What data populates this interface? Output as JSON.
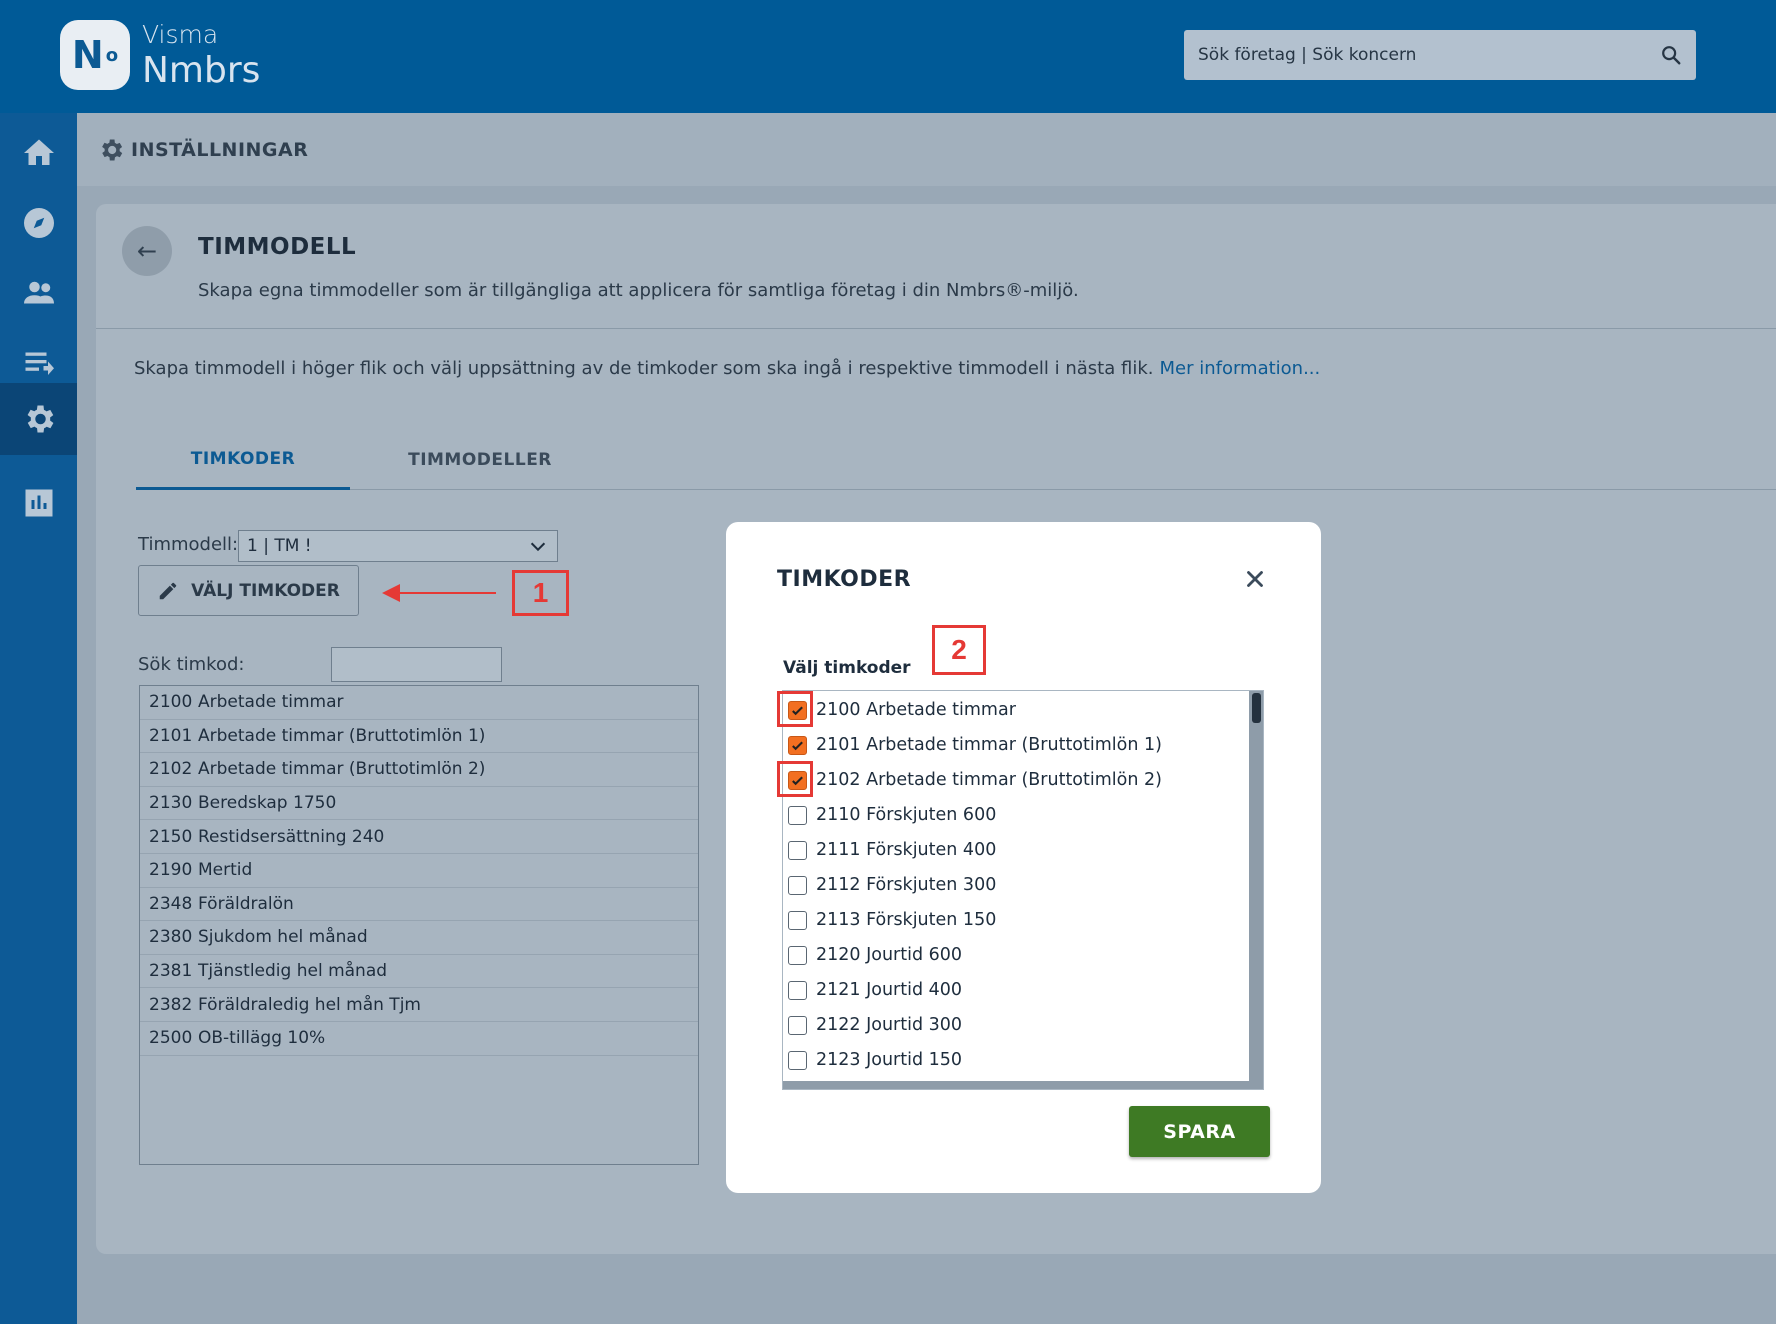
{
  "brand": {
    "logo_text": "N",
    "logo_sup": "o",
    "line1": "Visma",
    "line2": "Nmbrs"
  },
  "search": {
    "placeholder": "Sök företag | Sök koncern"
  },
  "nav": [
    "home-icon",
    "compass-icon",
    "people-icon",
    "list-icon",
    "gear-icon",
    "chart-icon"
  ],
  "breadcrumb": {
    "label": "INSTÄLLNINGAR"
  },
  "page": {
    "back": "←",
    "title": "TIMMODELL",
    "subtitle": "Skapa egna timmodeller som är tillgängliga att applicera för samtliga företag i din Nmbrs®-miljö.",
    "info": "Skapa timmodell i höger flik och välj uppsättning av de timkoder som ska ingå i respektive timmodell i nästa flik.",
    "info_link": "Mer information..."
  },
  "tabs": [
    {
      "label": "TIMKODER",
      "active": true
    },
    {
      "label": "TIMMODELLER",
      "active": false
    }
  ],
  "form": {
    "timmodell_label": "Timmodell:",
    "timmodell_value": "1 | TM !",
    "valj_button": "VÄLJ TIMKODER",
    "sok_label": "Sök timkod:"
  },
  "codes": [
    {
      "code": "2100",
      "name": "Arbetade timmar"
    },
    {
      "code": "2101",
      "name": "Arbetade timmar (Bruttotimlön 1)"
    },
    {
      "code": "2102",
      "name": "Arbetade timmar (Bruttotimlön 2)"
    },
    {
      "code": "2130",
      "name": "Beredskap 1750"
    },
    {
      "code": "2150",
      "name": "Restidsersättning 240"
    },
    {
      "code": "2190",
      "name": "Mertid"
    },
    {
      "code": "2348",
      "name": "Föräldralön"
    },
    {
      "code": "2380",
      "name": "Sjukdom hel månad"
    },
    {
      "code": "2381",
      "name": "Tjänstledig hel månad"
    },
    {
      "code": "2382",
      "name": "Föräldraledig hel mån Tjm"
    },
    {
      "code": "2500",
      "name": "OB-tillägg 10%"
    }
  ],
  "annotations": {
    "one": "1",
    "two": "2"
  },
  "modal": {
    "title": "TIMKODER",
    "label": "Välj timkoder",
    "items": [
      {
        "label": "2100 Arbetade timmar",
        "checked": true
      },
      {
        "label": "2101 Arbetade timmar (Bruttotimlön 1)",
        "checked": true
      },
      {
        "label": "2102 Arbetade timmar (Bruttotimlön 2)",
        "checked": true
      },
      {
        "label": "2110 Förskjuten 600",
        "checked": false
      },
      {
        "label": "2111 Förskjuten 400",
        "checked": false
      },
      {
        "label": "2112 Förskjuten 300",
        "checked": false
      },
      {
        "label": "2113 Förskjuten 150",
        "checked": false
      },
      {
        "label": "2120 Jourtid 600",
        "checked": false
      },
      {
        "label": "2121 Jourtid 400",
        "checked": false
      },
      {
        "label": "2122 Jourtid 300",
        "checked": false
      },
      {
        "label": "2123 Jourtid 150",
        "checked": false
      }
    ],
    "save": "SPARA"
  },
  "colors": {
    "brand_blue": "#005a97",
    "checkbox_orange": "#f26f21",
    "save_green": "#3e7a24",
    "annotation_red": "#e53935"
  }
}
